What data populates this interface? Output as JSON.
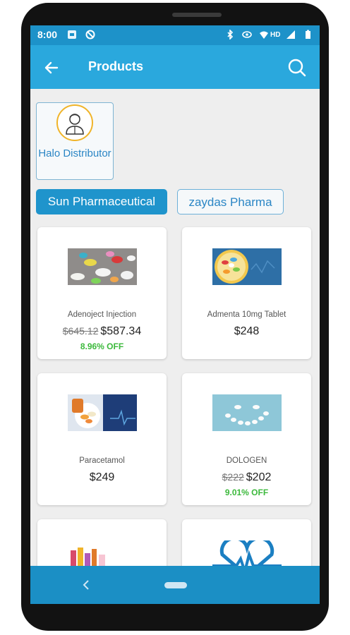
{
  "status_bar": {
    "time": "8:00",
    "network": "HD"
  },
  "app_bar": {
    "title": "Products"
  },
  "distributor": {
    "name": "Halo Distributor"
  },
  "filter_chips": [
    {
      "label": "Sun Pharmaceutical",
      "selected": true
    },
    {
      "label": "zaydas Pharma",
      "selected": false
    }
  ],
  "products": [
    {
      "name": "Adenoject Injection",
      "old_price": "$645.12",
      "price": "$587.34",
      "discount": "8.96% OFF"
    },
    {
      "name": "Admenta 10mg Tablet",
      "old_price": "",
      "price": "$248",
      "discount": ""
    },
    {
      "name": "Paracetamol",
      "old_price": "",
      "price": "$249",
      "discount": ""
    },
    {
      "name": "DOLOGEN",
      "old_price": "$222",
      "price": "$202",
      "discount": "9.01% OFF"
    }
  ],
  "colors": {
    "appbar": "#2aa8dd",
    "statusbar": "#1d92c9",
    "chip_active": "#1f94cc",
    "discount": "#3cb93c",
    "navbar": "#1b8fc5"
  }
}
